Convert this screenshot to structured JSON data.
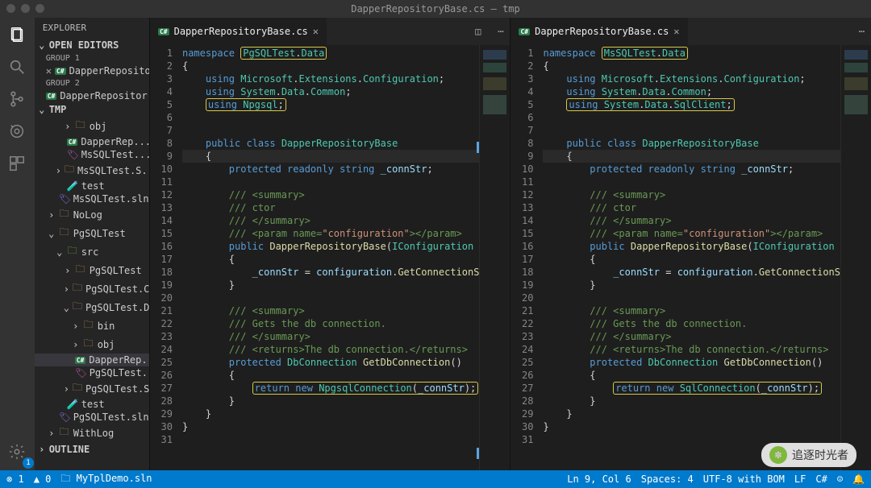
{
  "window": {
    "title": "DapperRepositoryBase.cs — tmp"
  },
  "sidebar": {
    "title": "EXPLORER",
    "open_editors": "OPEN EDITORS",
    "group1": "GROUP 1",
    "group2": "GROUP 2",
    "tmp": "TMP",
    "outline": "OUTLINE",
    "editor1": "DapperRepositor...",
    "editor2": "DapperRepositor...",
    "tree": [
      {
        "indent": 3,
        "type": "folder",
        "name": "obj",
        "chev": "›"
      },
      {
        "indent": 3,
        "type": "cs",
        "name": "DapperRep..."
      },
      {
        "indent": 3,
        "type": "csproj",
        "name": "MsSQLTest...."
      },
      {
        "indent": 2,
        "type": "folder",
        "name": "MsSQLTest.S...",
        "chev": "›"
      },
      {
        "indent": 2,
        "type": "test",
        "name": "test"
      },
      {
        "indent": 2,
        "type": "sln",
        "name": "MsSQLTest.sln"
      },
      {
        "indent": 1,
        "type": "folder",
        "name": "NoLog",
        "chev": "›"
      },
      {
        "indent": 1,
        "type": "folder-open",
        "name": "PgSQLTest",
        "chev": "⌄"
      },
      {
        "indent": 2,
        "type": "folder-open",
        "name": "src",
        "chev": "⌄",
        "green": true
      },
      {
        "indent": 3,
        "type": "folder",
        "name": "PgSQLTest",
        "chev": "›"
      },
      {
        "indent": 3,
        "type": "folder",
        "name": "PgSQLTest.C...",
        "chev": "›"
      },
      {
        "indent": 3,
        "type": "folder-open",
        "name": "PgSQLTest.D...",
        "chev": "⌄"
      },
      {
        "indent": 4,
        "type": "folder",
        "name": "bin",
        "chev": "›"
      },
      {
        "indent": 4,
        "type": "folder",
        "name": "obj",
        "chev": "›"
      },
      {
        "indent": 4,
        "type": "cs",
        "name": "DapperRep...",
        "sel": true
      },
      {
        "indent": 4,
        "type": "csproj",
        "name": "PgSQLTest...."
      },
      {
        "indent": 3,
        "type": "folder",
        "name": "PgSQLTest.S...",
        "chev": "›"
      },
      {
        "indent": 2,
        "type": "test",
        "name": "test"
      },
      {
        "indent": 2,
        "type": "sln",
        "name": "PgSQLTest.sln"
      },
      {
        "indent": 1,
        "type": "folder",
        "name": "WithLog",
        "chev": "›"
      }
    ]
  },
  "panes": [
    {
      "tab": "DapperRepositoryBase.cs",
      "lines": [
        "<span class='kw'>namespace</span> <span class='hl-box'><span class='cls'>PgSQLTest</span><span class='pln'>.</span><span class='cls'>Data</span></span>",
        "<span class='pln'>{</span>",
        "    <span class='kw'>using</span> <span class='cls'>Microsoft</span><span class='pln'>.</span><span class='cls'>Extensions</span><span class='pln'>.</span><span class='cls'>Configuration</span><span class='pln'>;</span>",
        "    <span class='kw'>using</span> <span class='cls'>System</span><span class='pln'>.</span><span class='cls'>Data</span><span class='pln'>.</span><span class='cls'>Common</span><span class='pln'>;</span>",
        "    <span class='hl-box'><span class='kw'>using</span> <span class='cls'>Npgsql</span><span class='pln'>;</span></span>",
        "",
        "",
        "    <span class='kw'>public</span> <span class='kw'>class</span> <span class='cls'>DapperRepositoryBase</span>",
        "    <span class='pln'>{</span>",
        "        <span class='kw'>protected</span> <span class='kw'>readonly</span> <span class='kw'>string</span> <span class='var'>_connStr</span><span class='pln'>;</span>",
        "",
        "        <span class='com'>/// &lt;summary&gt;</span>",
        "        <span class='com'>/// ctor</span>",
        "        <span class='com'>/// &lt;/summary&gt;</span>",
        "        <span class='com'>/// &lt;param name=</span><span class='str'>\"configuration\"</span><span class='com'>&gt;&lt;/param&gt;</span>",
        "        <span class='kw'>public</span> <span class='mth'>DapperRepositoryBase</span><span class='pln'>(</span><span class='cls'>IConfiguration</span>",
        "        <span class='pln'>{</span>",
        "            <span class='var'>_connStr</span> <span class='pln'>=</span> <span class='var'>configuration</span><span class='pln'>.</span><span class='mth'>GetConnectionS</span>",
        "        <span class='pln'>}</span>",
        "",
        "        <span class='com'>/// &lt;summary&gt;</span>",
        "        <span class='com'>/// Gets the db connection.</span>",
        "        <span class='com'>/// &lt;/summary&gt;</span>",
        "        <span class='com'>/// &lt;returns&gt;The db connection.&lt;/returns&gt;</span>",
        "        <span class='kw'>protected</span> <span class='cls'>DbConnection</span> <span class='mth'>GetDbConnection</span><span class='pln'>()</span>",
        "        <span class='pln'>{</span>",
        "            <span class='hl-box'><span class='kw'>return</span> <span class='kw'>new</span> <span class='cls'>NpgsqlConnection</span><span class='pln'>(</span><span class='var'>_connStr</span><span class='pln'>);</span></span>",
        "        <span class='pln'>}</span>",
        "    <span class='pln'>}</span>",
        "<span class='pln'>}</span>",
        ""
      ]
    },
    {
      "tab": "DapperRepositoryBase.cs",
      "lines": [
        "<span class='kw'>namespace</span> <span class='hl-box'><span class='cls'>MsSQLTest</span><span class='pln'>.</span><span class='cls'>Data</span></span>",
        "<span class='pln'>{</span>",
        "    <span class='kw'>using</span> <span class='cls'>Microsoft</span><span class='pln'>.</span><span class='cls'>Extensions</span><span class='pln'>.</span><span class='cls'>Configuration</span><span class='pln'>;</span>",
        "    <span class='kw'>using</span> <span class='cls'>System</span><span class='pln'>.</span><span class='cls'>Data</span><span class='pln'>.</span><span class='cls'>Common</span><span class='pln'>;</span>",
        "    <span class='hl-box'><span class='kw'>using</span> <span class='cls'>System</span><span class='pln'>.</span><span class='cls'>Data</span><span class='pln'>.</span><span class='cls'>SqlClient</span><span class='pln'>;</span></span>",
        "",
        "",
        "    <span class='kw'>public</span> <span class='kw'>class</span> <span class='cls'>DapperRepositoryBase</span>",
        "    <span class='pln'>{</span>",
        "        <span class='kw'>protected</span> <span class='kw'>readonly</span> <span class='kw'>string</span> <span class='var'>_connStr</span><span class='pln'>;</span>",
        "",
        "        <span class='com'>/// &lt;summary&gt;</span>",
        "        <span class='com'>/// ctor</span>",
        "        <span class='com'>/// &lt;/summary&gt;</span>",
        "        <span class='com'>/// &lt;param name=</span><span class='str'>\"configuration\"</span><span class='com'>&gt;&lt;/param&gt;</span>",
        "        <span class='kw'>public</span> <span class='mth'>DapperRepositoryBase</span><span class='pln'>(</span><span class='cls'>IConfiguration</span>",
        "        <span class='pln'>{</span>",
        "            <span class='var'>_connStr</span> <span class='pln'>=</span> <span class='var'>configuration</span><span class='pln'>.</span><span class='mth'>GetConnectionS</span>",
        "        <span class='pln'>}</span>",
        "",
        "        <span class='com'>/// &lt;summary&gt;</span>",
        "        <span class='com'>/// Gets the db connection.</span>",
        "        <span class='com'>/// &lt;/summary&gt;</span>",
        "        <span class='com'>/// &lt;returns&gt;The db connection.&lt;/returns&gt;</span>",
        "        <span class='kw'>protected</span> <span class='cls'>DbConnection</span> <span class='mth'>GetDbConnection</span><span class='pln'>()</span>",
        "        <span class='pln'>{</span>",
        "            <span class='hl-box'><span class='kw'>return</span> <span class='kw'>new</span> <span class='cls'>SqlConnection</span><span class='pln'>(</span><span class='var'>_connStr</span><span class='pln'>);</span></span>",
        "        <span class='pln'>}</span>",
        "    <span class='pln'>}</span>",
        "<span class='pln'>}</span>",
        ""
      ]
    }
  ],
  "status": {
    "errors": "⊗ 1",
    "warnings": "▲ 0",
    "project": "MyTplDemo.sln",
    "cursor": "Ln 9, Col 6",
    "spaces": "Spaces: 4",
    "encoding": "UTF-8 with BOM",
    "eol": "LF",
    "lang": "C#",
    "smile": "☺",
    "bell": "🔔"
  },
  "watermark": "追逐时光者"
}
